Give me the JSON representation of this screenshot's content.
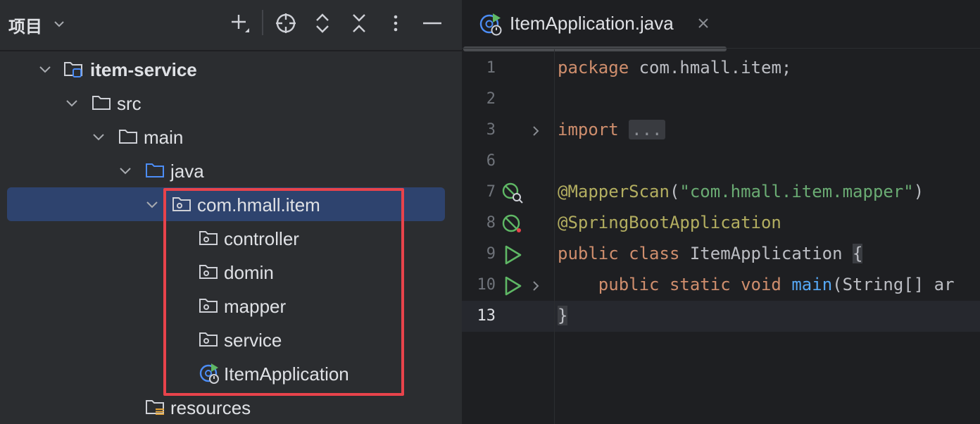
{
  "project_panel": {
    "title": "项目",
    "toolbar": [
      "add-icon",
      "locate-icon",
      "expand-all-icon",
      "collapse-all-icon",
      "more-options-icon",
      "hide-icon"
    ],
    "tree": [
      {
        "label": "item-service",
        "icon": "module-icon",
        "arrow": "expanded",
        "indent": 0,
        "bold": true
      },
      {
        "label": "src",
        "icon": "folder-icon",
        "arrow": "expanded",
        "indent": 1
      },
      {
        "label": "main",
        "icon": "folder-icon",
        "arrow": "expanded",
        "indent": 2
      },
      {
        "label": "java",
        "icon": "source-folder-icon",
        "arrow": "expanded",
        "indent": 3
      },
      {
        "label": "com.hmall.item",
        "icon": "package-icon",
        "arrow": "expanded",
        "indent": 4,
        "selected": true
      },
      {
        "label": "controller",
        "icon": "package-icon",
        "indent": 5
      },
      {
        "label": "domin",
        "icon": "package-icon",
        "indent": 5
      },
      {
        "label": "mapper",
        "icon": "package-icon",
        "indent": 5
      },
      {
        "label": "service",
        "icon": "package-icon",
        "indent": 5
      },
      {
        "label": "ItemApplication",
        "icon": "spring-boot-class-icon",
        "indent": 5
      },
      {
        "label": "resources",
        "icon": "resources-folder-icon",
        "indent": 3
      }
    ],
    "highlight_color": "#e8434b",
    "selection_color": "#2e436e"
  },
  "editor": {
    "tab": {
      "label": "ItemApplication.java",
      "icon": "spring-boot-class-icon"
    },
    "lines": [
      {
        "num": "1",
        "tokens": [
          {
            "t": "package",
            "c": "kw"
          },
          {
            "t": " com.hmall.item;",
            "c": ""
          }
        ]
      },
      {
        "num": "2",
        "tokens": []
      },
      {
        "num": "3",
        "fold": true,
        "tokens": [
          {
            "t": "import",
            "c": "kw"
          },
          {
            "t": " ",
            "c": ""
          },
          {
            "t": "...",
            "c": "fold-box"
          }
        ]
      },
      {
        "num": "6",
        "tokens": []
      },
      {
        "num": "7",
        "gutter": "bean-scan-icon",
        "tokens": [
          {
            "t": "@MapperScan",
            "c": "ann"
          },
          {
            "t": "(",
            "c": ""
          },
          {
            "t": "\"com.hmall.item.mapper\"",
            "c": "str"
          },
          {
            "t": ")",
            "c": ""
          }
        ]
      },
      {
        "num": "8",
        "gutter": "spring-boot-icon",
        "tokens": [
          {
            "t": "@SpringBootApplication",
            "c": "ann"
          }
        ]
      },
      {
        "num": "9",
        "gutter": "run-icon",
        "tokens": [
          {
            "t": "public class",
            "c": "kw"
          },
          {
            "t": " ItemApplication ",
            "c": ""
          },
          {
            "t": "{",
            "c": "brace-box"
          }
        ]
      },
      {
        "num": "10",
        "gutter": "run-icon",
        "fold": true,
        "tokens": [
          {
            "t": "    ",
            "c": ""
          },
          {
            "t": "public static void",
            "c": "kw"
          },
          {
            "t": " ",
            "c": ""
          },
          {
            "t": "main",
            "c": "fn"
          },
          {
            "t": "(String[] ar",
            "c": ""
          }
        ]
      },
      {
        "num": "13",
        "current": true,
        "tokens": [
          {
            "t": "}",
            "c": "brace-box"
          }
        ]
      }
    ],
    "colors": {
      "keyword": "#cf8e6d",
      "annotation": "#b3ae60",
      "string": "#6aab73",
      "method": "#56a8f5",
      "text": "#bcbec4"
    }
  }
}
